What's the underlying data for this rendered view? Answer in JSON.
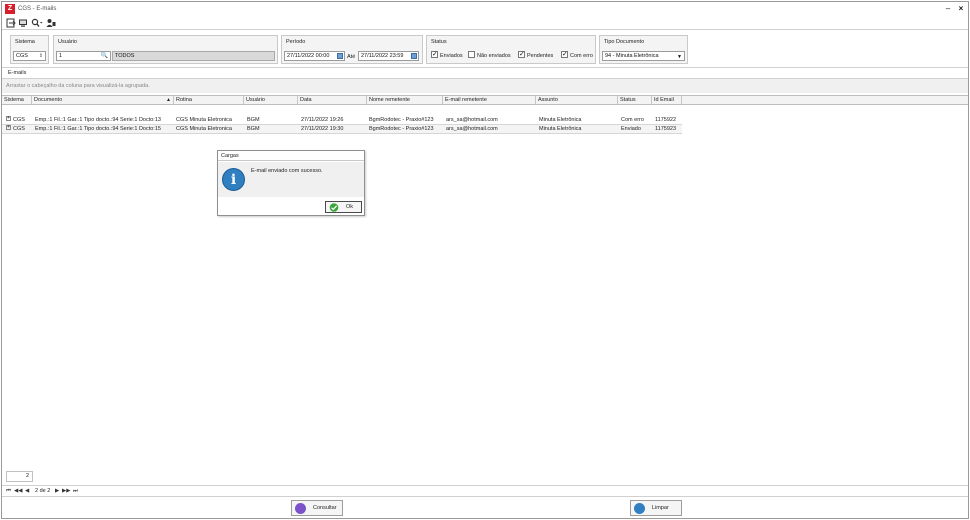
{
  "window": {
    "title": "CGS - E-mails",
    "logo": "Z"
  },
  "toolbar": {
    "icons": [
      "exit-icon",
      "display-icon",
      "search-dropdown-icon",
      "users-icon"
    ]
  },
  "filters": {
    "sistema": {
      "label": "Sistema",
      "value": "CGS"
    },
    "usuario": {
      "label": "Usuário",
      "code": "1",
      "name": "TODOS"
    },
    "periodo": {
      "label": "Período",
      "from": "27/11/2022 00:00",
      "to_label": "Até",
      "to": "27/11/2022 23:59"
    },
    "status": {
      "label": "Status",
      "enviados": "Enviados",
      "nao_enviados": "Não enviados",
      "pendentes": "Pendentes",
      "com_erro": "Com erro",
      "check_mark": "✓"
    },
    "tipo_documento": {
      "label": "Tipo Documento",
      "value": "94 - Minuta Eletrônica"
    }
  },
  "section": {
    "title": "E-mails",
    "group_hint": "Arrastar o cabeçalho da coluna para visualizá-la agrupada."
  },
  "grid": {
    "headers": [
      "Sistema",
      "Documento",
      "Rotina",
      "Usuário",
      "Data",
      "Nome remetente",
      "E-mail remetente",
      "Assunto",
      "Status",
      "Id Email"
    ],
    "rows": [
      [
        "CGS",
        "Emp.:1 Fil.:1 Gar.:1 Tipo docto.:94 Serie:1 Docto:13",
        "CGS Minuta Eletronica",
        "BGM",
        "27/11/2022 19:26",
        "BgmRodotec - Praxio#123",
        "ars_sa@hotmail.com",
        "Minuta Eletrônica",
        "Com erro",
        "1175922"
      ],
      [
        "CGS",
        "Emp.:1 Fil.:1 Gar.:1 Tipo docto.:94 Serie:1 Docto:15",
        "CGS Minuta Eletronica",
        "BGM",
        "27/11/2022 19:30",
        "BgmRodotec - Praxio#123",
        "ars_sa@hotmail.com",
        "Minuta Eletrônica",
        "Enviado",
        "1175923"
      ]
    ],
    "expander": "+",
    "sort_glyph": "▲"
  },
  "footer": {
    "count": "2",
    "pager_text": "2 de 2",
    "first": "⏮",
    "prev_page": "◀◀",
    "prev": "◀",
    "next": "▶",
    "next_page": "▶▶",
    "last": "⏭"
  },
  "actions": {
    "consultar": "Consultar",
    "limpar": "Limpar"
  },
  "dialog": {
    "title": "Cargas",
    "message": "E-mail enviado com sucesso.",
    "ok": "Ok",
    "info_glyph": "i"
  },
  "colors": {
    "accent_red": "#d71f2b",
    "info_blue": "#2f7fc1",
    "consultar_icon": "#7b52c9",
    "limpar_icon": "#2f7fc1"
  }
}
